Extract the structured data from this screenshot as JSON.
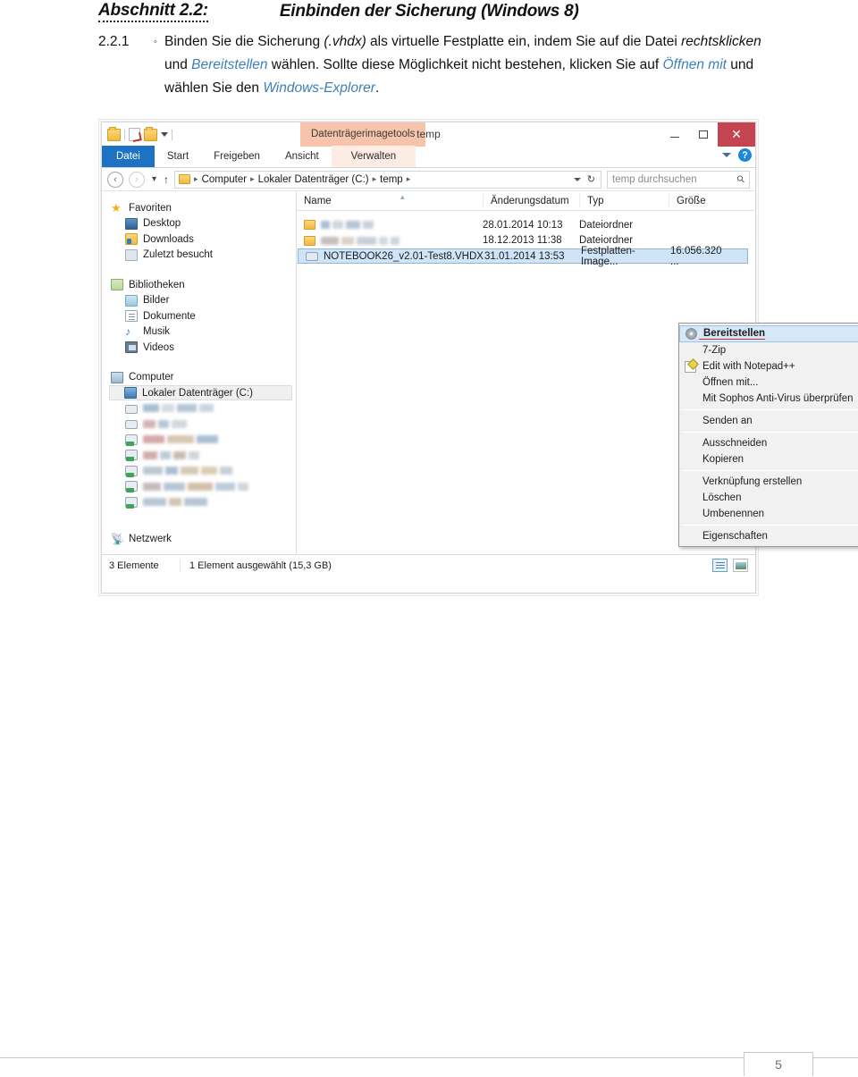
{
  "document": {
    "heading_number": "Abschnitt 2.2:",
    "heading_title": "Einbinden der Sicherung (Windows 8)",
    "step_number": "2.2.1",
    "bullet": "◦",
    "paragraph": {
      "p1": "Binden Sie die Sicherung ",
      "p2_italic": "(.vhdx)",
      "p3": " als virtuelle Festplatte ein, indem Sie auf die Datei ",
      "p4_italic": "rechtsklicken",
      "p5": " und ",
      "p6_link": "Bereitstellen",
      "p7": " wählen. Sollte diese Möglichkeit nicht bestehen, klicken Sie auf ",
      "p8_link": "Öffnen mit",
      "p9": " und wählen Sie den ",
      "p10_link": "Windows-Explorer",
      "p11": "."
    },
    "page_number": "5"
  },
  "explorer": {
    "titlebar": {
      "contextual_tab_group": "Datenträgerimagetools",
      "window_title": "temp",
      "minimize": "–",
      "maximize": "□",
      "close": "✕",
      "quick_access_icons": [
        "folder-icon",
        "properties-icon",
        "new-folder-icon",
        "customize-chevron-icon"
      ]
    },
    "ribbon_tabs": [
      {
        "label": "Datei",
        "state": "file-menu"
      },
      {
        "label": "Start",
        "state": "normal"
      },
      {
        "label": "Freigeben",
        "state": "normal"
      },
      {
        "label": "Ansicht",
        "state": "normal"
      },
      {
        "label": "Verwalten",
        "state": "contextual-active"
      }
    ],
    "ribbon_right": {
      "collapse_icon": "chevron-down-icon",
      "help_label": "?"
    },
    "addressbar": {
      "back": "‹",
      "forward": "›",
      "recent_chevron": "▾",
      "up": "↑",
      "crumbs": [
        "Computer",
        "Lokaler Datenträger (C:)",
        "temp"
      ],
      "separator": "▸",
      "dropdown": "chevron-down-icon",
      "refresh": "↻",
      "search_placeholder": "temp durchsuchen"
    },
    "navpane": {
      "groups": [
        {
          "header": {
            "label": "Favoriten",
            "icon": "star-icon"
          },
          "items": [
            {
              "label": "Desktop",
              "icon": "desktop-icon"
            },
            {
              "label": "Downloads",
              "icon": "downloads-icon"
            },
            {
              "label": "Zuletzt besucht",
              "icon": "recent-places-icon"
            }
          ]
        },
        {
          "header": {
            "label": "Bibliotheken",
            "icon": "libraries-icon"
          },
          "items": [
            {
              "label": "Bilder",
              "icon": "pictures-icon"
            },
            {
              "label": "Dokumente",
              "icon": "documents-icon"
            },
            {
              "label": "Musik",
              "icon": "music-icon"
            },
            {
              "label": "Videos",
              "icon": "videos-icon"
            }
          ]
        },
        {
          "header": {
            "label": "Computer",
            "icon": "computer-icon"
          },
          "items": [
            {
              "label": "Lokaler Datenträger (C:)",
              "icon": "hard-drive-icon",
              "selected": true
            },
            {
              "label": "",
              "icon": "disk-drive-icon",
              "redacted": true,
              "redacted_width": 78
            },
            {
              "label": "",
              "icon": "disk-drive-icon",
              "redacted": true,
              "redacted_width": 55
            },
            {
              "label": "",
              "icon": "network-drive-icon",
              "redacted": true,
              "redacted_width": 100
            },
            {
              "label": "",
              "icon": "network-drive-icon",
              "redacted": true,
              "redacted_width": 72
            },
            {
              "label": "",
              "icon": "network-drive-icon",
              "redacted": true,
              "redacted_width": 140
            },
            {
              "label": "",
              "icon": "network-drive-icon",
              "redacted": true,
              "redacted_width": 152
            },
            {
              "label": "",
              "icon": "network-drive-icon",
              "redacted": true,
              "redacted_width": 108
            }
          ]
        },
        {
          "header": {
            "label": "Netzwerk",
            "icon": "network-icon"
          },
          "items": []
        }
      ]
    },
    "filelist": {
      "columns": [
        "Name",
        "Änderungsdatum",
        "Typ",
        "Größe"
      ],
      "sort_indicator": "▴",
      "rows": [
        {
          "name": "",
          "redacted": true,
          "redacted_width": 58,
          "icon": "folder-icon",
          "date": "28.01.2014 10:13",
          "type": "Dateiordner",
          "size": ""
        },
        {
          "name": "",
          "redacted": true,
          "redacted_width": 96,
          "icon": "folder-icon",
          "date": "18.12.2013 11:38",
          "type": "Dateiordner",
          "size": ""
        },
        {
          "name": "NOTEBOOK26_v2.01-Test8.VHDX",
          "redacted": false,
          "icon": "vhd-file-icon",
          "date": "31.01.2014 13:53",
          "type": "Festplatten-Image...",
          "size": "16.056.320 ...",
          "selected": true
        }
      ]
    },
    "contextmenu": {
      "items": [
        {
          "label": "Bereitstellen",
          "icon": "cd-drive-icon",
          "highlighted": true,
          "annotated": true
        },
        {
          "label": "7-Zip",
          "icon": "",
          "submenu": true
        },
        {
          "label": "Edit with Notepad++",
          "icon": "notepad-plus-icon"
        },
        {
          "label": "Öffnen mit...",
          "icon": ""
        },
        {
          "label": "Mit Sophos Anti-Virus überprüfen",
          "icon": ""
        },
        {
          "separator": true
        },
        {
          "label": "Senden an",
          "icon": "",
          "submenu": true
        },
        {
          "separator": true
        },
        {
          "label": "Ausschneiden",
          "icon": ""
        },
        {
          "label": "Kopieren",
          "icon": ""
        },
        {
          "separator": true
        },
        {
          "label": "Verknüpfung erstellen",
          "icon": ""
        },
        {
          "label": "Löschen",
          "icon": ""
        },
        {
          "label": "Umbenennen",
          "icon": ""
        },
        {
          "separator": true
        },
        {
          "label": "Eigenschaften",
          "icon": ""
        }
      ],
      "submenu_arrow": "▸"
    },
    "statusbar": {
      "item_count": "3 Elemente",
      "selection": "1 Element ausgewählt (15,3 GB)",
      "views": [
        {
          "name": "details-view-button",
          "active": true
        },
        {
          "name": "thumbnail-view-button",
          "active": false
        }
      ]
    }
  },
  "colors": {
    "link": "#3d7fb8",
    "file_tab": "#1e72c4",
    "contextual_tab": "#f6c4ab",
    "close_button": "#c4454f",
    "selection": "#cfe4f7",
    "annotation_underline": "#d03030"
  }
}
